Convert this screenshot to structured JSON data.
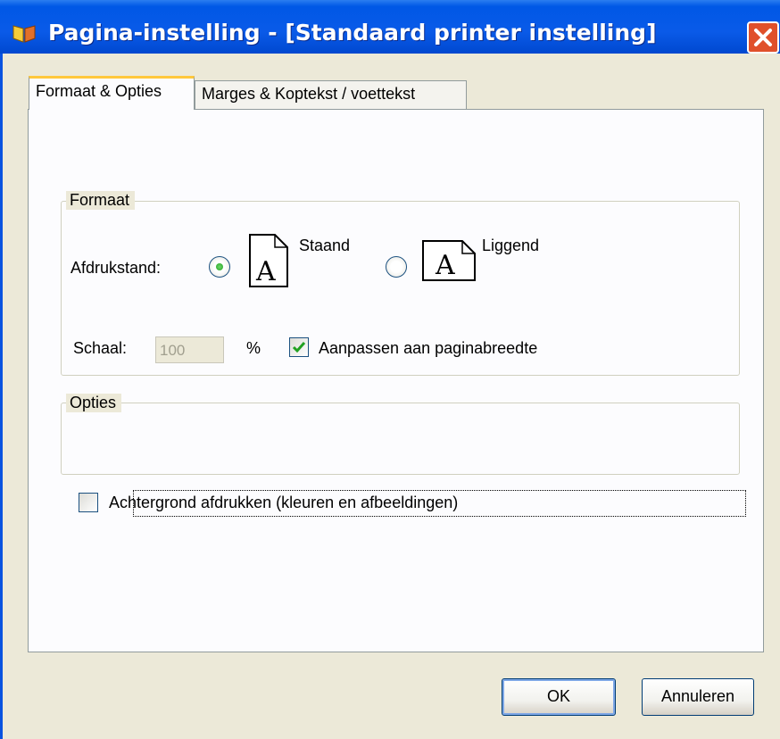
{
  "window": {
    "title": "Pagina-instelling - [Standaard printer instelling]",
    "icon": "app-shield-icon",
    "close_icon": "close-icon",
    "accent_color": "#0a5ae8",
    "close_color": "#e0502b"
  },
  "tabs": [
    {
      "label": "Formaat & Opties",
      "active": true
    },
    {
      "label": "Marges & Koptekst / voettekst",
      "active": false
    }
  ],
  "formaat": {
    "legend": "Formaat",
    "orientation_label": "Afdrukstand:",
    "portrait": {
      "label": "Staand",
      "selected": true,
      "icon": "portrait-page-icon",
      "glyph": "A"
    },
    "landscape": {
      "label": "Liggend",
      "selected": false,
      "icon": "landscape-page-icon",
      "glyph": "A"
    },
    "scale_label": "Schaal:",
    "scale_value": "100",
    "scale_disabled": true,
    "percent_sign": "%",
    "fit_width": {
      "label": "Aanpassen aan paginabreedte",
      "checked": true
    }
  },
  "opties": {
    "legend": "Opties",
    "print_background": {
      "label": "Achtergrond afdrukken (kleuren en afbeeldingen)",
      "checked": false
    }
  },
  "buttons": {
    "ok": "OK",
    "cancel": "Annuleren"
  }
}
